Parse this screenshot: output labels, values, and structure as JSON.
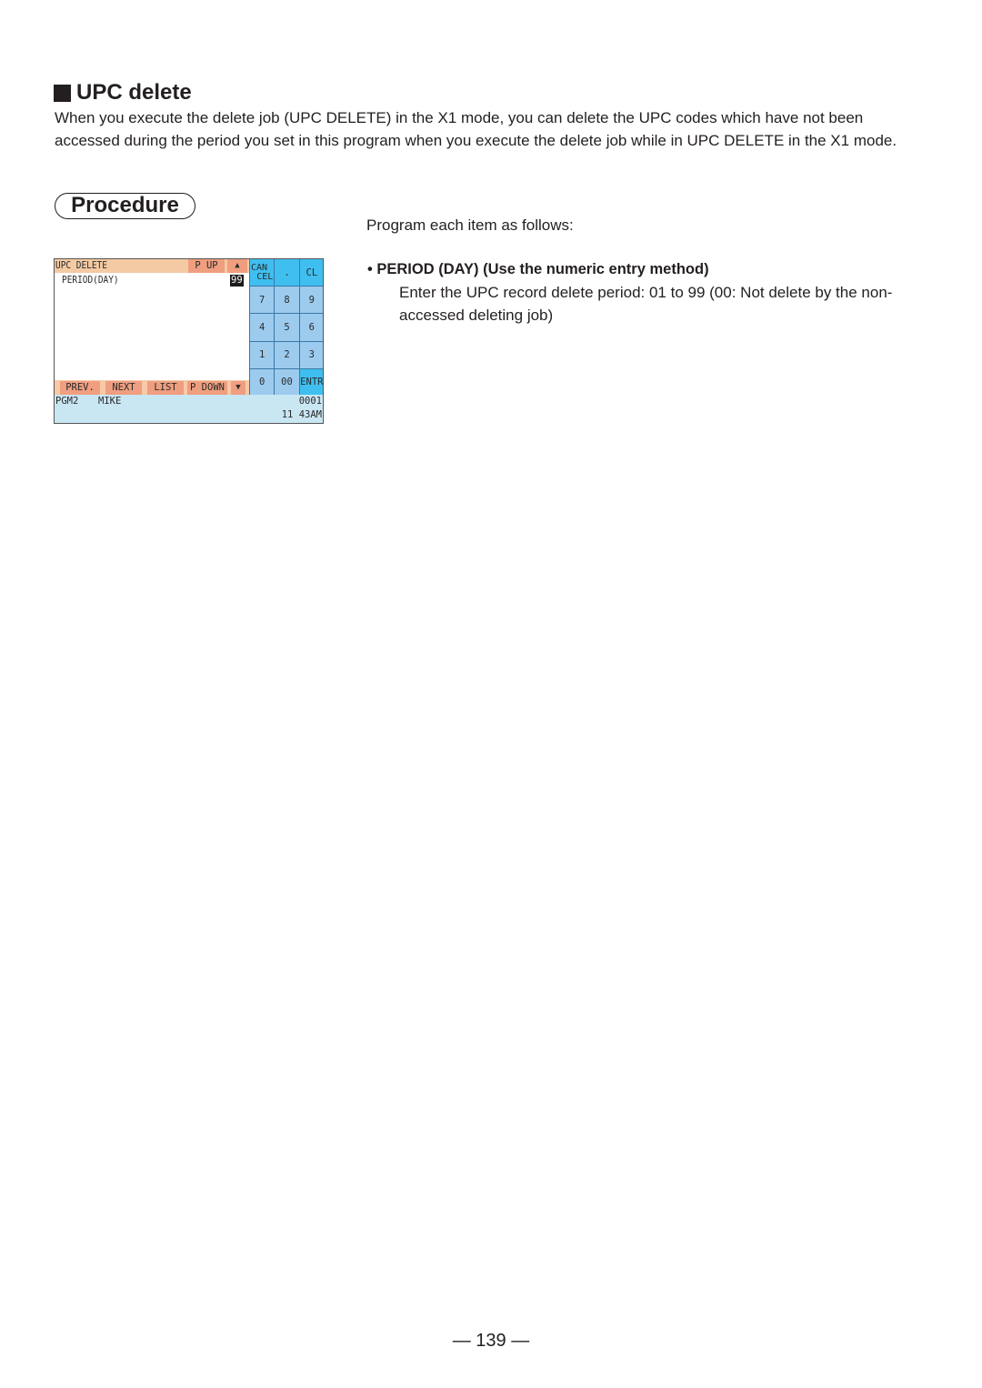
{
  "section": {
    "icon": "black-square-icon",
    "title": "UPC delete",
    "intro": "When you execute the delete job (UPC DELETE) in the X1 mode, you can delete the UPC codes which have not been accessed during the period you set in this program when you execute the delete job while in UPC DELETE in the X1 mode."
  },
  "procedure_label": "Procedure",
  "instructions": {
    "lead": "Program each item as follows:",
    "items": [
      {
        "heading": "• PERIOD (DAY) (Use the numeric entry method)",
        "description": "Enter the UPC record delete period: 01 to 99 (00: Not delete by the non-accessed deleting job)"
      }
    ]
  },
  "pos_screen": {
    "title": "UPC DELETE",
    "page_up": "P UP",
    "up_arrow": "▲",
    "field_label": "PERIOD(DAY)",
    "field_value": "99",
    "function_keys": [
      "PREV.",
      "NEXT",
      "LIST",
      "P DOWN",
      "▼"
    ],
    "keypad": [
      [
        "CAN",
        "CEL"
      ],
      ".",
      "CL",
      "7",
      "8",
      "9",
      "4",
      "5",
      "6",
      "1",
      "2",
      "3",
      "0",
      "00",
      "ENTR"
    ],
    "status": {
      "mode": "PGM2",
      "clerk": "MIKE",
      "counter": "0001",
      "time": "11 43AM"
    },
    "colors": {
      "title_bar": "#f4caa4",
      "button_orange": "#ef9e80",
      "key_blue": "#9ccbee",
      "key_highlight": "#3fbff0",
      "status_bg": "#c9e6f3"
    }
  },
  "page_number": "— 139 —"
}
